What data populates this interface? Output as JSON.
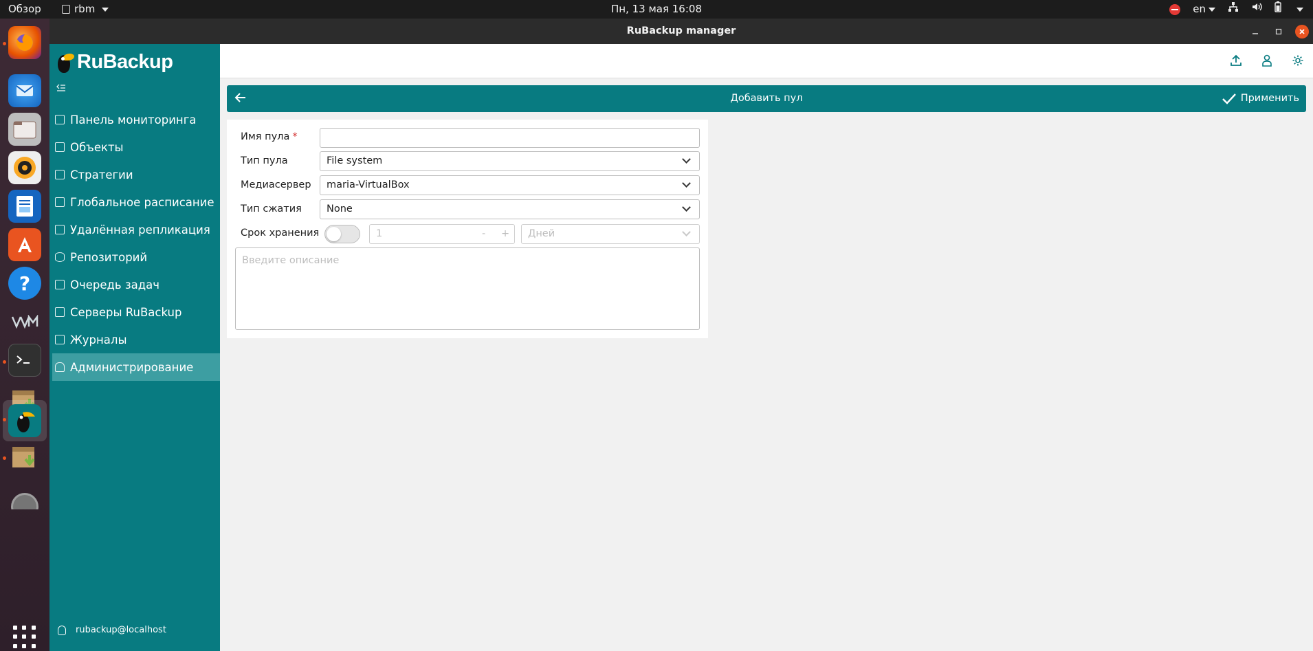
{
  "topbar": {
    "activities": "Обзор",
    "app_name": "rbm",
    "clock": "Пн, 13 мая  16:08",
    "language": "en"
  },
  "window": {
    "title": "RuBackup manager"
  },
  "dock": {
    "items": [
      "firefox",
      "thunderbird",
      "files",
      "rhythmbox",
      "writer",
      "app-center",
      "help",
      "vm",
      "terminal",
      "installer",
      "rubackup",
      "installer-2",
      "disk"
    ]
  },
  "sidebar": {
    "logo_text": "RuBackup",
    "items": [
      {
        "label": "Панель мониторинга",
        "icon": "dashboard-icon"
      },
      {
        "label": "Объекты",
        "icon": "monitor-icon"
      },
      {
        "label": "Стратегии",
        "icon": "document-icon"
      },
      {
        "label": "Глобальное расписание",
        "icon": "schedule-icon"
      },
      {
        "label": "Удалённая репликация",
        "icon": "replication-icon"
      },
      {
        "label": "Репозиторий",
        "icon": "database-icon"
      },
      {
        "label": "Очередь задач",
        "icon": "task-queue-icon"
      },
      {
        "label": "Серверы RuBackup",
        "icon": "server-icon"
      },
      {
        "label": "Журналы",
        "icon": "log-icon"
      },
      {
        "label": "Администрирование",
        "icon": "admin-icon",
        "active": true
      }
    ],
    "user": "rubackup@localhost"
  },
  "pagebar": {
    "title": "Добавить пул",
    "apply_label": "Применить"
  },
  "form": {
    "pool_name_label": "Имя пула",
    "pool_name_required": "*",
    "pool_name_value": "",
    "pool_type_label": "Тип пула",
    "pool_type_value": "File system",
    "media_server_label": "Медиасервер",
    "media_server_value": "maria-VirtualBox",
    "compression_label": "Тип сжатия",
    "compression_value": "None",
    "retention_label": "Срок хранения",
    "retention_enabled": false,
    "retention_value": "1",
    "retention_minus": "-",
    "retention_plus": "+",
    "retention_unit": "Дней",
    "description_placeholder": "Введите описание"
  },
  "colors": {
    "accent": "#087b81",
    "active_nav": "#3d9ea2",
    "close_button": "#e95420",
    "required": "#d32f2f"
  }
}
